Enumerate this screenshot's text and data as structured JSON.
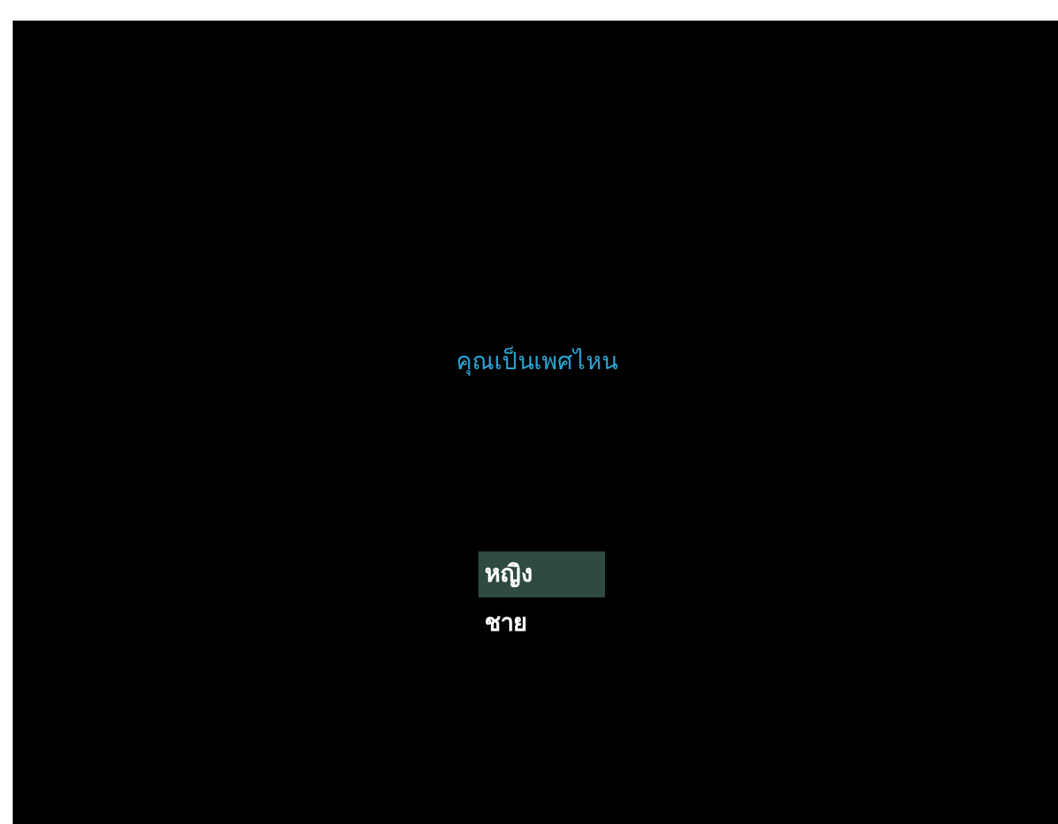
{
  "question": "คุณเป็นเพศไหน",
  "options": [
    {
      "label": "หญิง",
      "selected": true
    },
    {
      "label": "ชาย",
      "selected": false
    }
  ]
}
